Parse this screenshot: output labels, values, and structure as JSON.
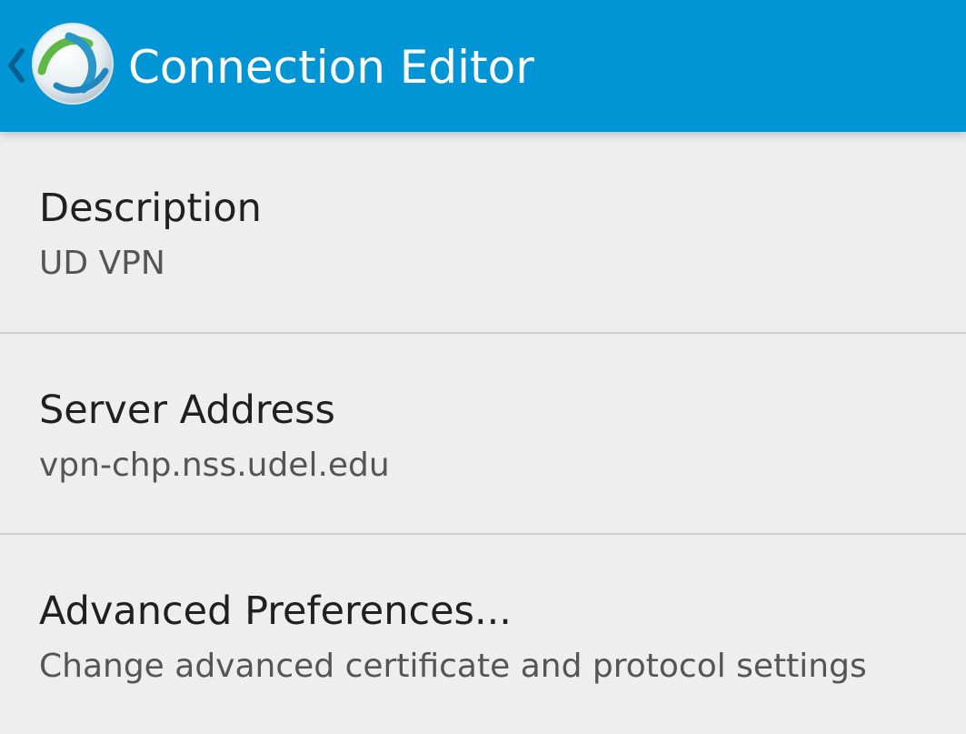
{
  "action_bar": {
    "title": "Connection Editor",
    "icon": "anyconnect-logo-icon",
    "up_icon": "chevron-left-icon",
    "background_color": "#0295d6"
  },
  "preferences": [
    {
      "title": "Description",
      "summary": "UD VPN"
    },
    {
      "title": "Server Address",
      "summary": "vpn-chp.nss.udel.edu"
    },
    {
      "title": "Advanced Preferences...",
      "summary": "Change advanced certificate and protocol settings"
    }
  ]
}
